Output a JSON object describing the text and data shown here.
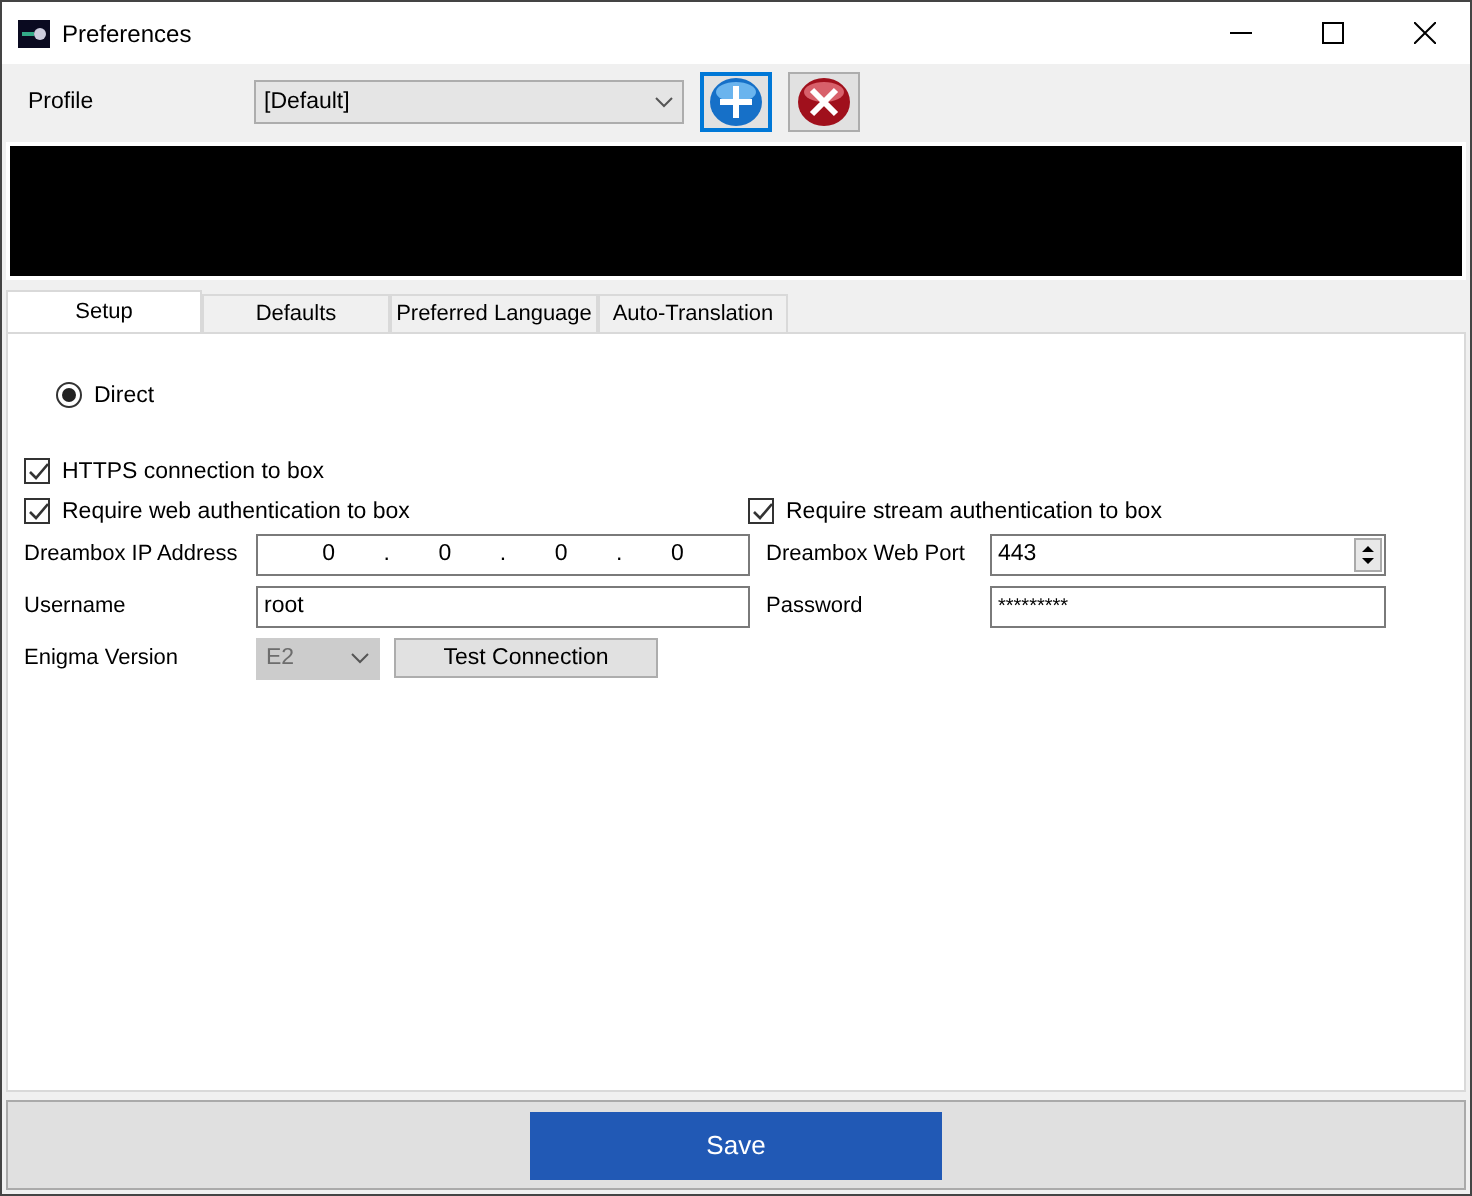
{
  "window": {
    "title": "Preferences"
  },
  "profile": {
    "label": "Profile",
    "value": "[Default]"
  },
  "tabs": [
    {
      "label": "Setup",
      "selected": true
    },
    {
      "label": "Defaults",
      "selected": false
    },
    {
      "label": "Preferred Language",
      "selected": false
    },
    {
      "label": "Auto-Translation",
      "selected": false
    }
  ],
  "connection": {
    "label": "Direct",
    "selected": true
  },
  "checkboxes_left": [
    {
      "label": "HTTPS connection to box",
      "checked": true
    },
    {
      "label": "Require web authentication to box",
      "checked": true
    }
  ],
  "stream_auth": {
    "label": "Require stream authentication to box",
    "checked": true
  },
  "ip_address": {
    "label": "Dreambox IP Address",
    "octets": [
      "0",
      "0",
      "0",
      "0"
    ],
    "separator": "."
  },
  "username": {
    "label": "Username",
    "value": "root"
  },
  "enigma": {
    "label": "Enigma Version",
    "value": "E2",
    "disabled": true
  },
  "test_button": "Test Connection",
  "web_port": {
    "label": "Dreambox Web Port",
    "value": "443"
  },
  "password": {
    "label": "Password",
    "value": "*********"
  },
  "save_button": "Save"
}
